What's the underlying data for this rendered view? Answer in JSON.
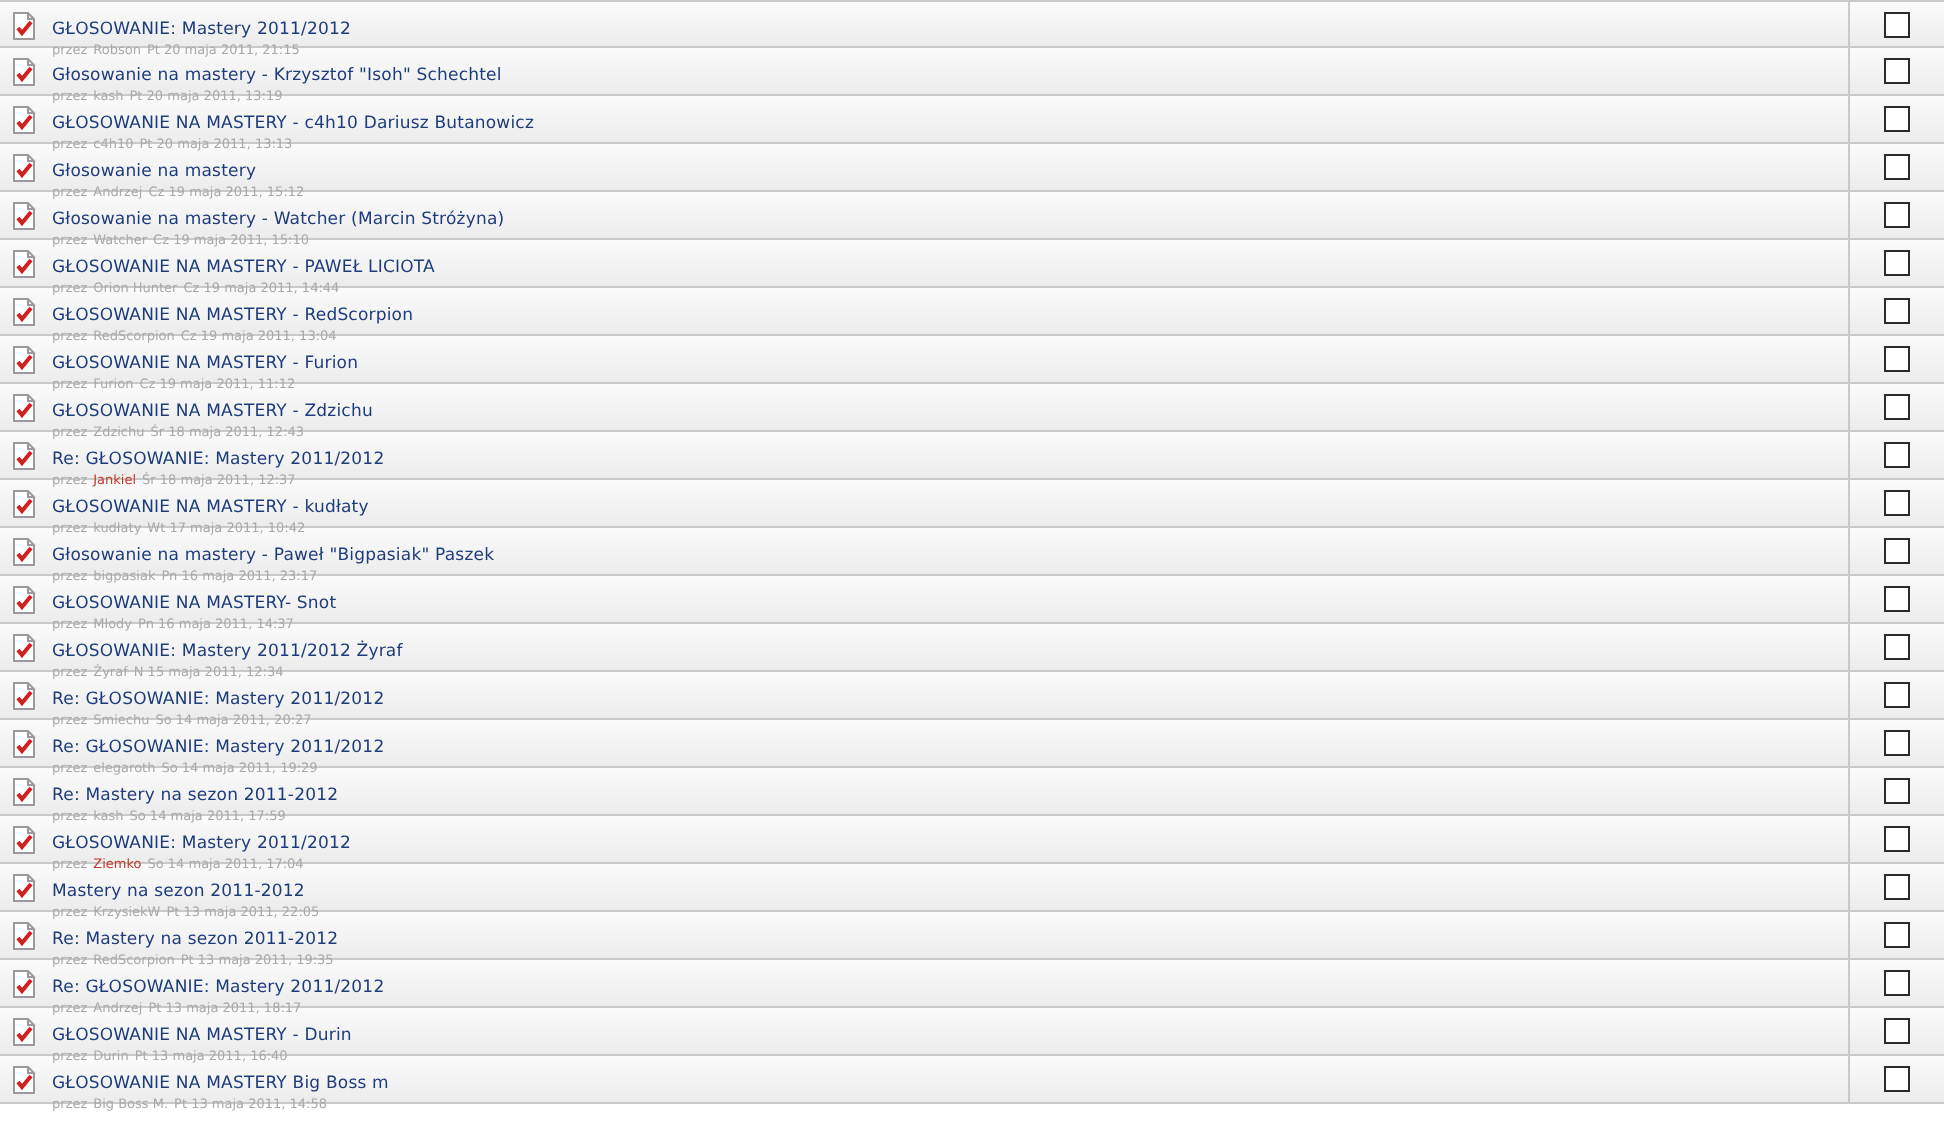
{
  "topics": [
    {
      "title": "GŁOSOWANIE: Mastery 2011/2012",
      "by": "przez",
      "author": "Robson",
      "color": "#a9a9a9",
      "date": "Pt 20 maja 2011, 21:15",
      "checked": false
    },
    {
      "title": "Głosowanie na mastery - Krzysztof \"Isoh\" Schechtel",
      "by": "przez",
      "author": "kash",
      "color": "#a9a9a9",
      "date": "Pt 20 maja 2011, 13:19",
      "checked": false
    },
    {
      "title": "GŁOSOWANIE NA MASTERY - c4h10 Dariusz Butanowicz",
      "by": "przez",
      "author": "c4h10",
      "color": "#a9a9a9",
      "date": "Pt 20 maja 2011, 13:13",
      "checked": false
    },
    {
      "title": "Głosowanie na mastery",
      "by": "przez",
      "author": "Andrzej",
      "color": "#a9a9a9",
      "date": "Cz 19 maja 2011, 15:12",
      "checked": false
    },
    {
      "title": "Głosowanie na mastery - Watcher (Marcin Stróżyna)",
      "by": "przez",
      "author": "Watcher",
      "color": "#a9a9a9",
      "date": "Cz 19 maja 2011, 15:10",
      "checked": false
    },
    {
      "title": "GŁOSOWANIE NA MASTERY - PAWEŁ LICIOTA",
      "by": "przez",
      "author": "Orion Hunter",
      "color": "#a9a9a9",
      "date": "Cz 19 maja 2011, 14:44",
      "checked": false
    },
    {
      "title": "GŁOSOWANIE NA MASTERY - RedScorpion",
      "by": "przez",
      "author": "RedScorpion",
      "color": "#a9a9a9",
      "date": "Cz 19 maja 2011, 13:04",
      "checked": false
    },
    {
      "title": "GŁOSOWANIE NA MASTERY - Furion",
      "by": "przez",
      "author": "Furion",
      "color": "#a9a9a9",
      "date": "Cz 19 maja 2011, 11:12",
      "checked": false
    },
    {
      "title": "GŁOSOWANIE NA MASTERY - Zdzichu",
      "by": "przez",
      "author": "Zdzichu",
      "color": "#a9a9a9",
      "date": "Śr 18 maja 2011, 12:43",
      "checked": false
    },
    {
      "title": "Re: GŁOSOWANIE: Mastery 2011/2012",
      "by": "przez",
      "author": "Jankiel",
      "color": "#c0392b",
      "date": "Śr 18 maja 2011, 12:37",
      "checked": false
    },
    {
      "title": "GŁOSOWANIE NA MASTERY - kudłaty",
      "by": "przez",
      "author": "kudłaty",
      "color": "#a9a9a9",
      "date": "Wt 17 maja 2011, 10:42",
      "checked": false
    },
    {
      "title": "Głosowanie na mastery - Paweł \"Bigpasiak\" Paszek",
      "by": "przez",
      "author": "bigpasiak",
      "color": "#a9a9a9",
      "date": "Pn 16 maja 2011, 23:17",
      "checked": false
    },
    {
      "title": "GŁOSOWANIE NA MASTERY- Snot",
      "by": "przez",
      "author": "Młody",
      "color": "#a9a9a9",
      "date": "Pn 16 maja 2011, 14:37",
      "checked": false
    },
    {
      "title": "GŁOSOWANIE: Mastery 2011/2012 Żyraf",
      "by": "przez",
      "author": "Żyraf",
      "color": "#a9a9a9",
      "date": "N 15 maja 2011, 12:34",
      "checked": false
    },
    {
      "title": "Re: GŁOSOWANIE: Mastery 2011/2012",
      "by": "przez",
      "author": "Smiechu",
      "color": "#a9a9a9",
      "date": "So 14 maja 2011, 20:27",
      "checked": false
    },
    {
      "title": "Re: GŁOSOWANIE: Mastery 2011/2012",
      "by": "przez",
      "author": "elegaroth",
      "color": "#a9a9a9",
      "date": "So 14 maja 2011, 19:29",
      "checked": false
    },
    {
      "title": "Re: Mastery na sezon 2011-2012",
      "by": "przez",
      "author": "kash",
      "color": "#a9a9a9",
      "date": "So 14 maja 2011, 17:59",
      "checked": false
    },
    {
      "title": "GŁOSOWANIE: Mastery 2011/2012",
      "by": "przez",
      "author": "Ziemko",
      "color": "#c0392b",
      "date": "So 14 maja 2011, 17:04",
      "checked": false
    },
    {
      "title": "Mastery na sezon 2011-2012",
      "by": "przez",
      "author": "KrzysiekW",
      "color": "#a9a9a9",
      "date": "Pt 13 maja 2011, 22:05",
      "checked": false
    },
    {
      "title": "Re: Mastery na sezon 2011-2012",
      "by": "przez",
      "author": "RedScorpion",
      "color": "#a9a9a9",
      "date": "Pt 13 maja 2011, 19:35",
      "checked": false
    },
    {
      "title": "Re: GŁOSOWANIE: Mastery 2011/2012",
      "by": "przez",
      "author": "Andrzej",
      "color": "#a9a9a9",
      "date": "Pt 13 maja 2011, 18:17",
      "checked": false
    },
    {
      "title": "GŁOSOWANIE NA MASTERY - Durin",
      "by": "przez",
      "author": "Durin",
      "color": "#a9a9a9",
      "date": "Pt 13 maja 2011, 16:40",
      "checked": false
    },
    {
      "title": "GŁOSOWANIE NA MASTERY Big Boss m",
      "by": "przez",
      "author": "Big Boss M.",
      "color": "#a9a9a9",
      "date": "Pt 13 maja 2011, 14:58",
      "checked": false
    }
  ]
}
